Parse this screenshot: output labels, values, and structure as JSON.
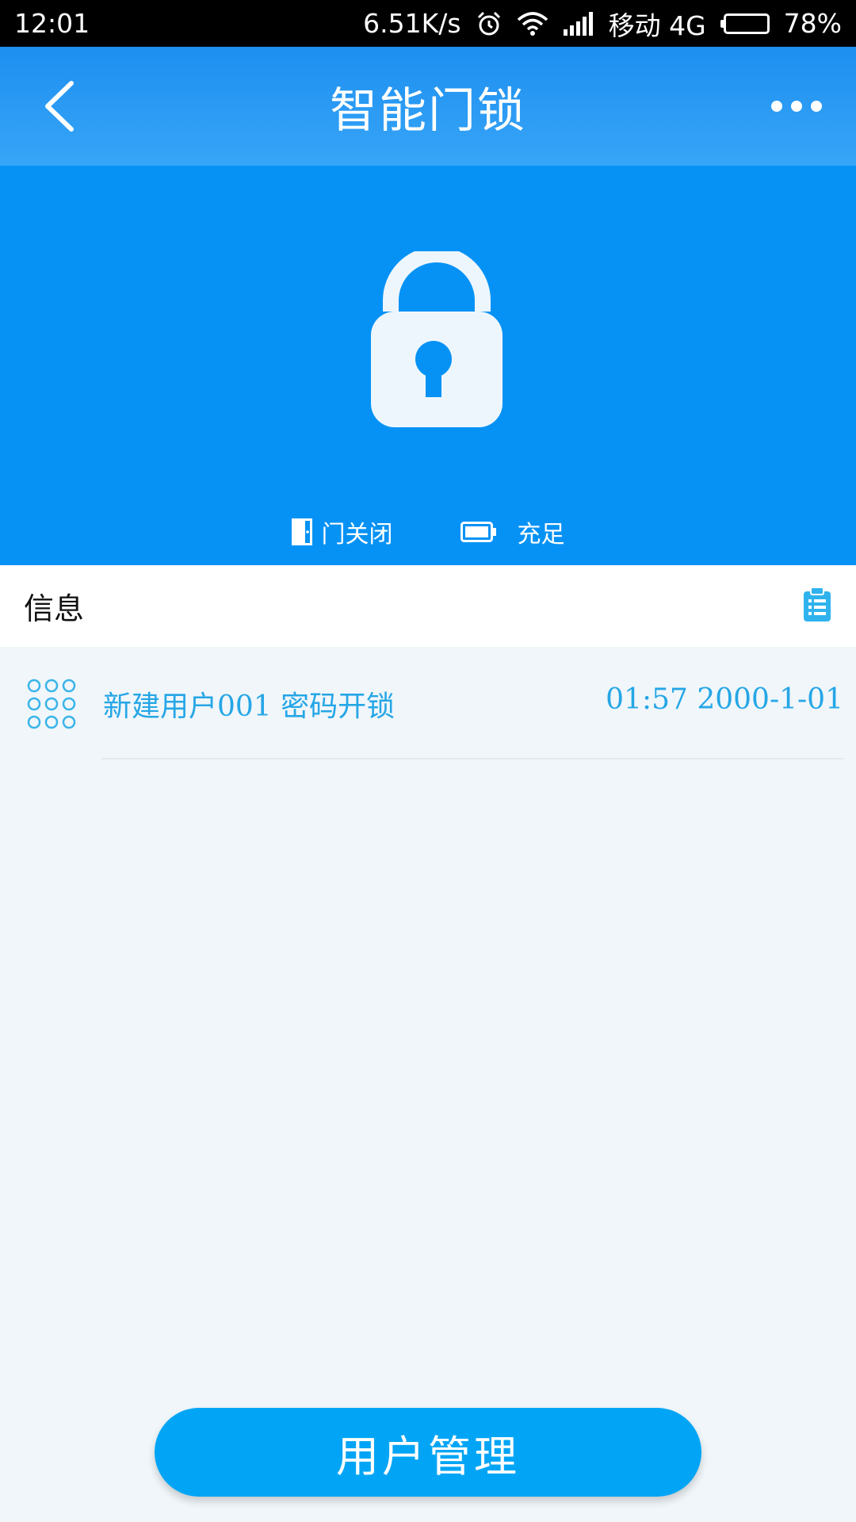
{
  "status_bar": {
    "time": "12:01",
    "net_speed": "6.51K/s",
    "carrier": "移动 4G",
    "battery_percent": "78%",
    "battery_level": 0.78
  },
  "header": {
    "title": "智能门锁",
    "back_icon": "chevron-left-icon",
    "more_icon": "more-horizontal-icon"
  },
  "lock_status": {
    "lock_icon": "padlock-icon",
    "door_state": "门关闭",
    "battery_state": "充足"
  },
  "info": {
    "title": "信息",
    "clipboard_icon": "clipboard-list-icon"
  },
  "logs": [
    {
      "text": "新建用户001 密码开锁",
      "time": "01:57 2000-1-01",
      "icon": "keypad-icon"
    }
  ],
  "bottom": {
    "user_management_label": "用户管理"
  },
  "colors": {
    "header": "#2a9af4",
    "hero": "#0692f5",
    "accent_text": "#25a6e6",
    "button": "#02a5f5",
    "background": "#f0f6fa"
  }
}
